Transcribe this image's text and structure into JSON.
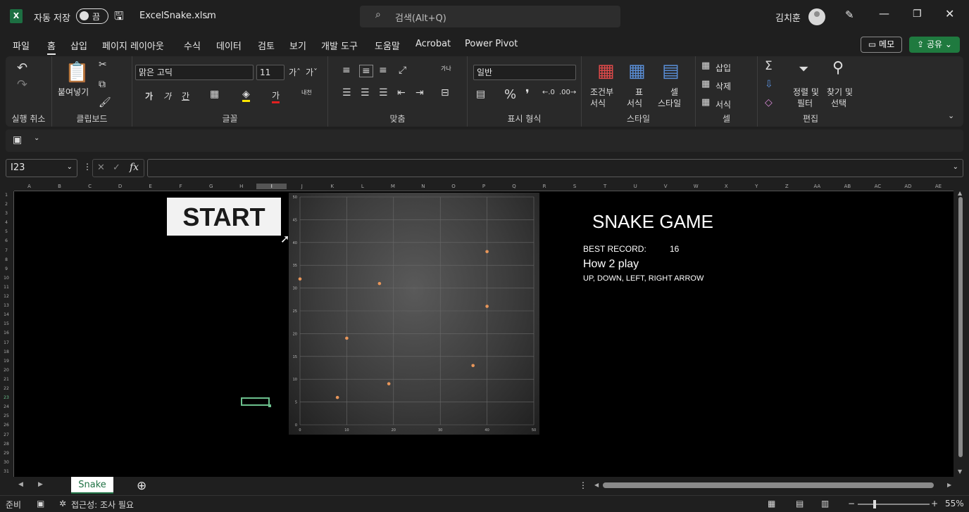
{
  "titlebar": {
    "autosave_label": "자동 저장",
    "autosave_state": "끔",
    "filename": "ExcelSnake.xlsm",
    "search_placeholder": "검색(Alt+Q)",
    "user": "김치훈"
  },
  "menu": {
    "items": [
      "파일",
      "홈",
      "삽입",
      "페이지 레이아웃",
      "수식",
      "데이터",
      "검토",
      "보기",
      "개발 도구",
      "도움말",
      "Acrobat",
      "Power Pivot"
    ],
    "active": "홈",
    "memo": "메모",
    "share": "공유"
  },
  "ribbon": {
    "undo_group": "실행 취소",
    "clipboard": {
      "paste": "붙여넣기",
      "label": "클립보드"
    },
    "font": {
      "name": "맑은 고딕",
      "size": "11",
      "label": "글꼴",
      "b": "가",
      "i": "가",
      "u": "간",
      "color_a": "가",
      "phonetic": "내천"
    },
    "align": {
      "label": "맞춤",
      "wrap": "가나"
    },
    "number": {
      "format": "일반",
      "label": "표시 형식"
    },
    "styles": {
      "cond": "조건부\n서식",
      "cond1": "조건부",
      "cond2": "서식",
      "table1": "표",
      "table2": "서식",
      "cell1": "셀",
      "cell2": "스타일",
      "label": "스타일"
    },
    "cells": {
      "insert": "삽입",
      "delete": "삭제",
      "format": "서식",
      "label": "셀"
    },
    "edit": {
      "sort1": "정렬 및",
      "sort2": "필터",
      "find1": "찾기 및",
      "find2": "선택",
      "label": "편집"
    }
  },
  "formula": {
    "namebox": "I23",
    "value": "",
    "fx": "fx"
  },
  "columns": [
    "A",
    "B",
    "C",
    "D",
    "E",
    "F",
    "G",
    "H",
    "I",
    "J",
    "K",
    "L",
    "M",
    "N",
    "O",
    "P",
    "Q",
    "R",
    "S",
    "T",
    "U",
    "V",
    "W",
    "X",
    "Y",
    "Z",
    "AA",
    "AB",
    "AC",
    "AD",
    "AE"
  ],
  "rows": [
    "1",
    "2",
    "3",
    "4",
    "5",
    "6",
    "7",
    "8",
    "9",
    "10",
    "11",
    "12",
    "13",
    "14",
    "15",
    "16",
    "17",
    "18",
    "19",
    "20",
    "21",
    "22",
    "23",
    "24",
    "25",
    "26",
    "27",
    "28",
    "29",
    "30",
    "31"
  ],
  "sheet": {
    "start_button": "START",
    "game_title": "SNAKE GAME",
    "best_label": "BEST RECORD:",
    "best_value": "16",
    "howto": "How 2 play",
    "controls": "UP, DOWN, LEFT, RIGHT ARROW"
  },
  "chart_data": {
    "type": "scatter",
    "x": [
      0,
      8,
      10,
      17,
      19,
      37,
      40,
      40
    ],
    "y": [
      32,
      6,
      19,
      31,
      9,
      13,
      26,
      38
    ],
    "xlim": [
      0,
      50
    ],
    "ylim": [
      0,
      50
    ],
    "xticks": [
      "0",
      "10",
      "20",
      "30",
      "40",
      "50"
    ],
    "yticks": [
      "0",
      "5",
      "10",
      "15",
      "20",
      "25",
      "30",
      "35",
      "40",
      "45",
      "50"
    ],
    "grid": true,
    "marker_color": "#e8965a"
  },
  "tabs": {
    "sheet_name": "Snake"
  },
  "status": {
    "ready": "준비",
    "accessibility": "접근성: 조사 필요",
    "zoom": "55%"
  }
}
